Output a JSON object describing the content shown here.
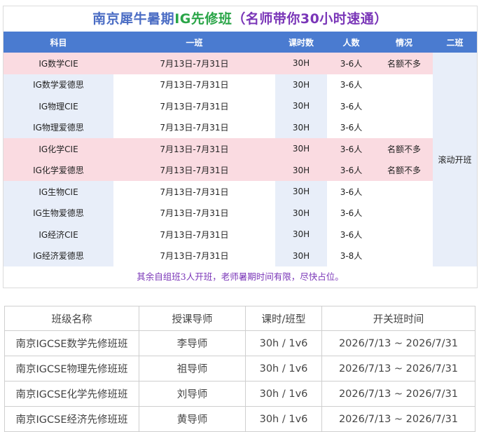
{
  "schedule": {
    "title_prefix": "南京犀牛暑期",
    "title_ig": "IG先修班",
    "title_sub": "（名师带你30小时速通）",
    "headers": [
      "科目",
      "一班",
      "课时数",
      "人数",
      "情况",
      "二班"
    ],
    "second_class": "滚动开班",
    "rows": [
      {
        "subject": "IG数学CIE",
        "date": "7月13日-7月31日",
        "hours": "30H",
        "size": "3-6人",
        "status": "名额不多",
        "highlight": true
      },
      {
        "subject": "IG数学爱德思",
        "date": "7月13日-7月31日",
        "hours": "30H",
        "size": "3-6人",
        "status": "",
        "highlight": false
      },
      {
        "subject": "IG物理CIE",
        "date": "7月13日-7月31日",
        "hours": "30H",
        "size": "3-6人",
        "status": "",
        "highlight": false
      },
      {
        "subject": "IG物理爱德思",
        "date": "7月13日-7月31日",
        "hours": "30H",
        "size": "3-6人",
        "status": "",
        "highlight": false
      },
      {
        "subject": "IG化学CIE",
        "date": "7月13日-7月31日",
        "hours": "30H",
        "size": "3-6人",
        "status": "名额不多",
        "highlight": true
      },
      {
        "subject": "IG化学爱德思",
        "date": "7月13日-7月31日",
        "hours": "30H",
        "size": "3-6人",
        "status": "名额不多",
        "highlight": true
      },
      {
        "subject": "IG生物CIE",
        "date": "7月13日-7月31日",
        "hours": "30H",
        "size": "3-6人",
        "status": "",
        "highlight": false
      },
      {
        "subject": "IG生物爱德思",
        "date": "7月13日-7月31日",
        "hours": "30H",
        "size": "3-6人",
        "status": "",
        "highlight": false
      },
      {
        "subject": "IG经济CIE",
        "date": "7月13日-7月31日",
        "hours": "30H",
        "size": "3-6人",
        "status": "",
        "highlight": false
      },
      {
        "subject": "IG经济爱德思",
        "date": "7月13日-7月31日",
        "hours": "30H",
        "size": "3-8人",
        "status": "",
        "highlight": false
      }
    ],
    "note": "其余自组班3人开班，老师暑期时间有限，尽快占位。",
    "colors": {
      "header_bg": "#4a7bd0",
      "highlight_bg": "#fadbe1",
      "alt_bg": "#e8eef9",
      "title": "#4a6cc4",
      "title_ig": "#2aa548",
      "accent": "#7a36b8"
    }
  },
  "classes": {
    "headers": [
      "班级名称",
      "授课导师",
      "课时/班型",
      "开关班时间"
    ],
    "rows": [
      {
        "name": "南京IGCSE数学先修班班",
        "teacher": "李导师",
        "format": "30h / 1v6",
        "period": "2026/7/13 ~ 2026/7/31"
      },
      {
        "name": "南京IGCSE物理先修班班",
        "teacher": "祖导师",
        "format": "30h / 1v6",
        "period": "2026/7/13 ~ 2026/7/31"
      },
      {
        "name": "南京IGCSE化学先修班班",
        "teacher": "刘导师",
        "format": "30h / 1v6",
        "period": "2026/7/13 ~ 2026/7/31"
      },
      {
        "name": "南京IGCSE经济先修班班",
        "teacher": "黄导师",
        "format": "30h / 1v6",
        "period": "2026/7/13 ~ 2026/7/31"
      }
    ]
  }
}
